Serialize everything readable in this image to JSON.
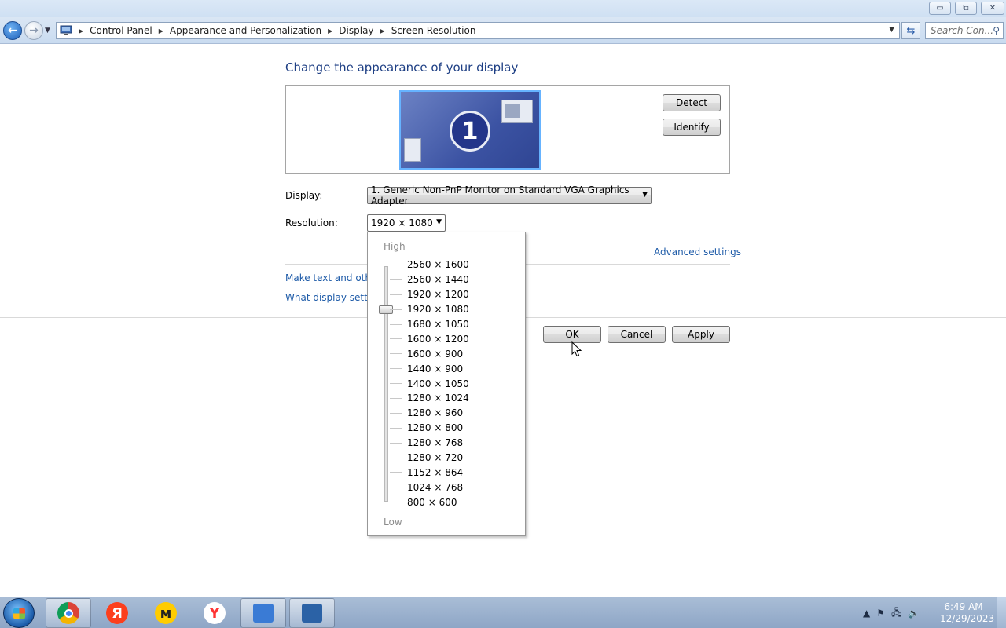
{
  "window": {
    "minimize": "▭",
    "maximize": "⧉",
    "close": "✕"
  },
  "address_bar": {
    "breadcrumbs": [
      "Control Panel",
      "Appearance and Personalization",
      "Display",
      "Screen Resolution"
    ],
    "search_placeholder": "Search Con..."
  },
  "main": {
    "heading": "Change the appearance of your display",
    "monitor_number": "1",
    "detect_label": "Detect",
    "identify_label": "Identify",
    "display_label": "Display:",
    "display_value": "1. Generic Non-PnP Monitor on Standard VGA Graphics Adapter",
    "resolution_label": "Resolution:",
    "resolution_value": "1920 × 1080",
    "advanced_link": "Advanced settings",
    "link_text_size": "Make text and other",
    "link_display_settings": "What display setting",
    "ok_label": "OK",
    "cancel_label": "Cancel",
    "apply_label": "Apply"
  },
  "resolution_dropdown": {
    "high_label": "High",
    "low_label": "Low",
    "selected": "1920 × 1080",
    "options": [
      "2560 × 1600",
      "2560 × 1440",
      "1920 × 1200",
      "1920 × 1080",
      "1680 × 1050",
      "1600 × 1200",
      "1600 × 900",
      "1440 × 900",
      "1400 × 1050",
      "1280 × 1024",
      "1280 × 960",
      "1280 × 800",
      "1280 × 768",
      "1280 × 720",
      "1152 × 864",
      "1024 × 768",
      "800 × 600"
    ]
  },
  "taskbar": {
    "apps": [
      {
        "name": "chrome",
        "glyph": "",
        "color": "#db4437"
      },
      {
        "name": "yandex",
        "glyph": "Я",
        "color": "#fc3f1d"
      },
      {
        "name": "yandex-market",
        "glyph": "м",
        "color": "#ffcc00"
      },
      {
        "name": "yandex-browser",
        "glyph": "Y",
        "color": "#ff3333"
      },
      {
        "name": "control-panel",
        "glyph": "",
        "color": "#3a7bd5"
      },
      {
        "name": "virtualbox",
        "glyph": "",
        "color": "#2b62a6"
      }
    ],
    "time": "6:49 AM",
    "date": "12/29/2023"
  }
}
